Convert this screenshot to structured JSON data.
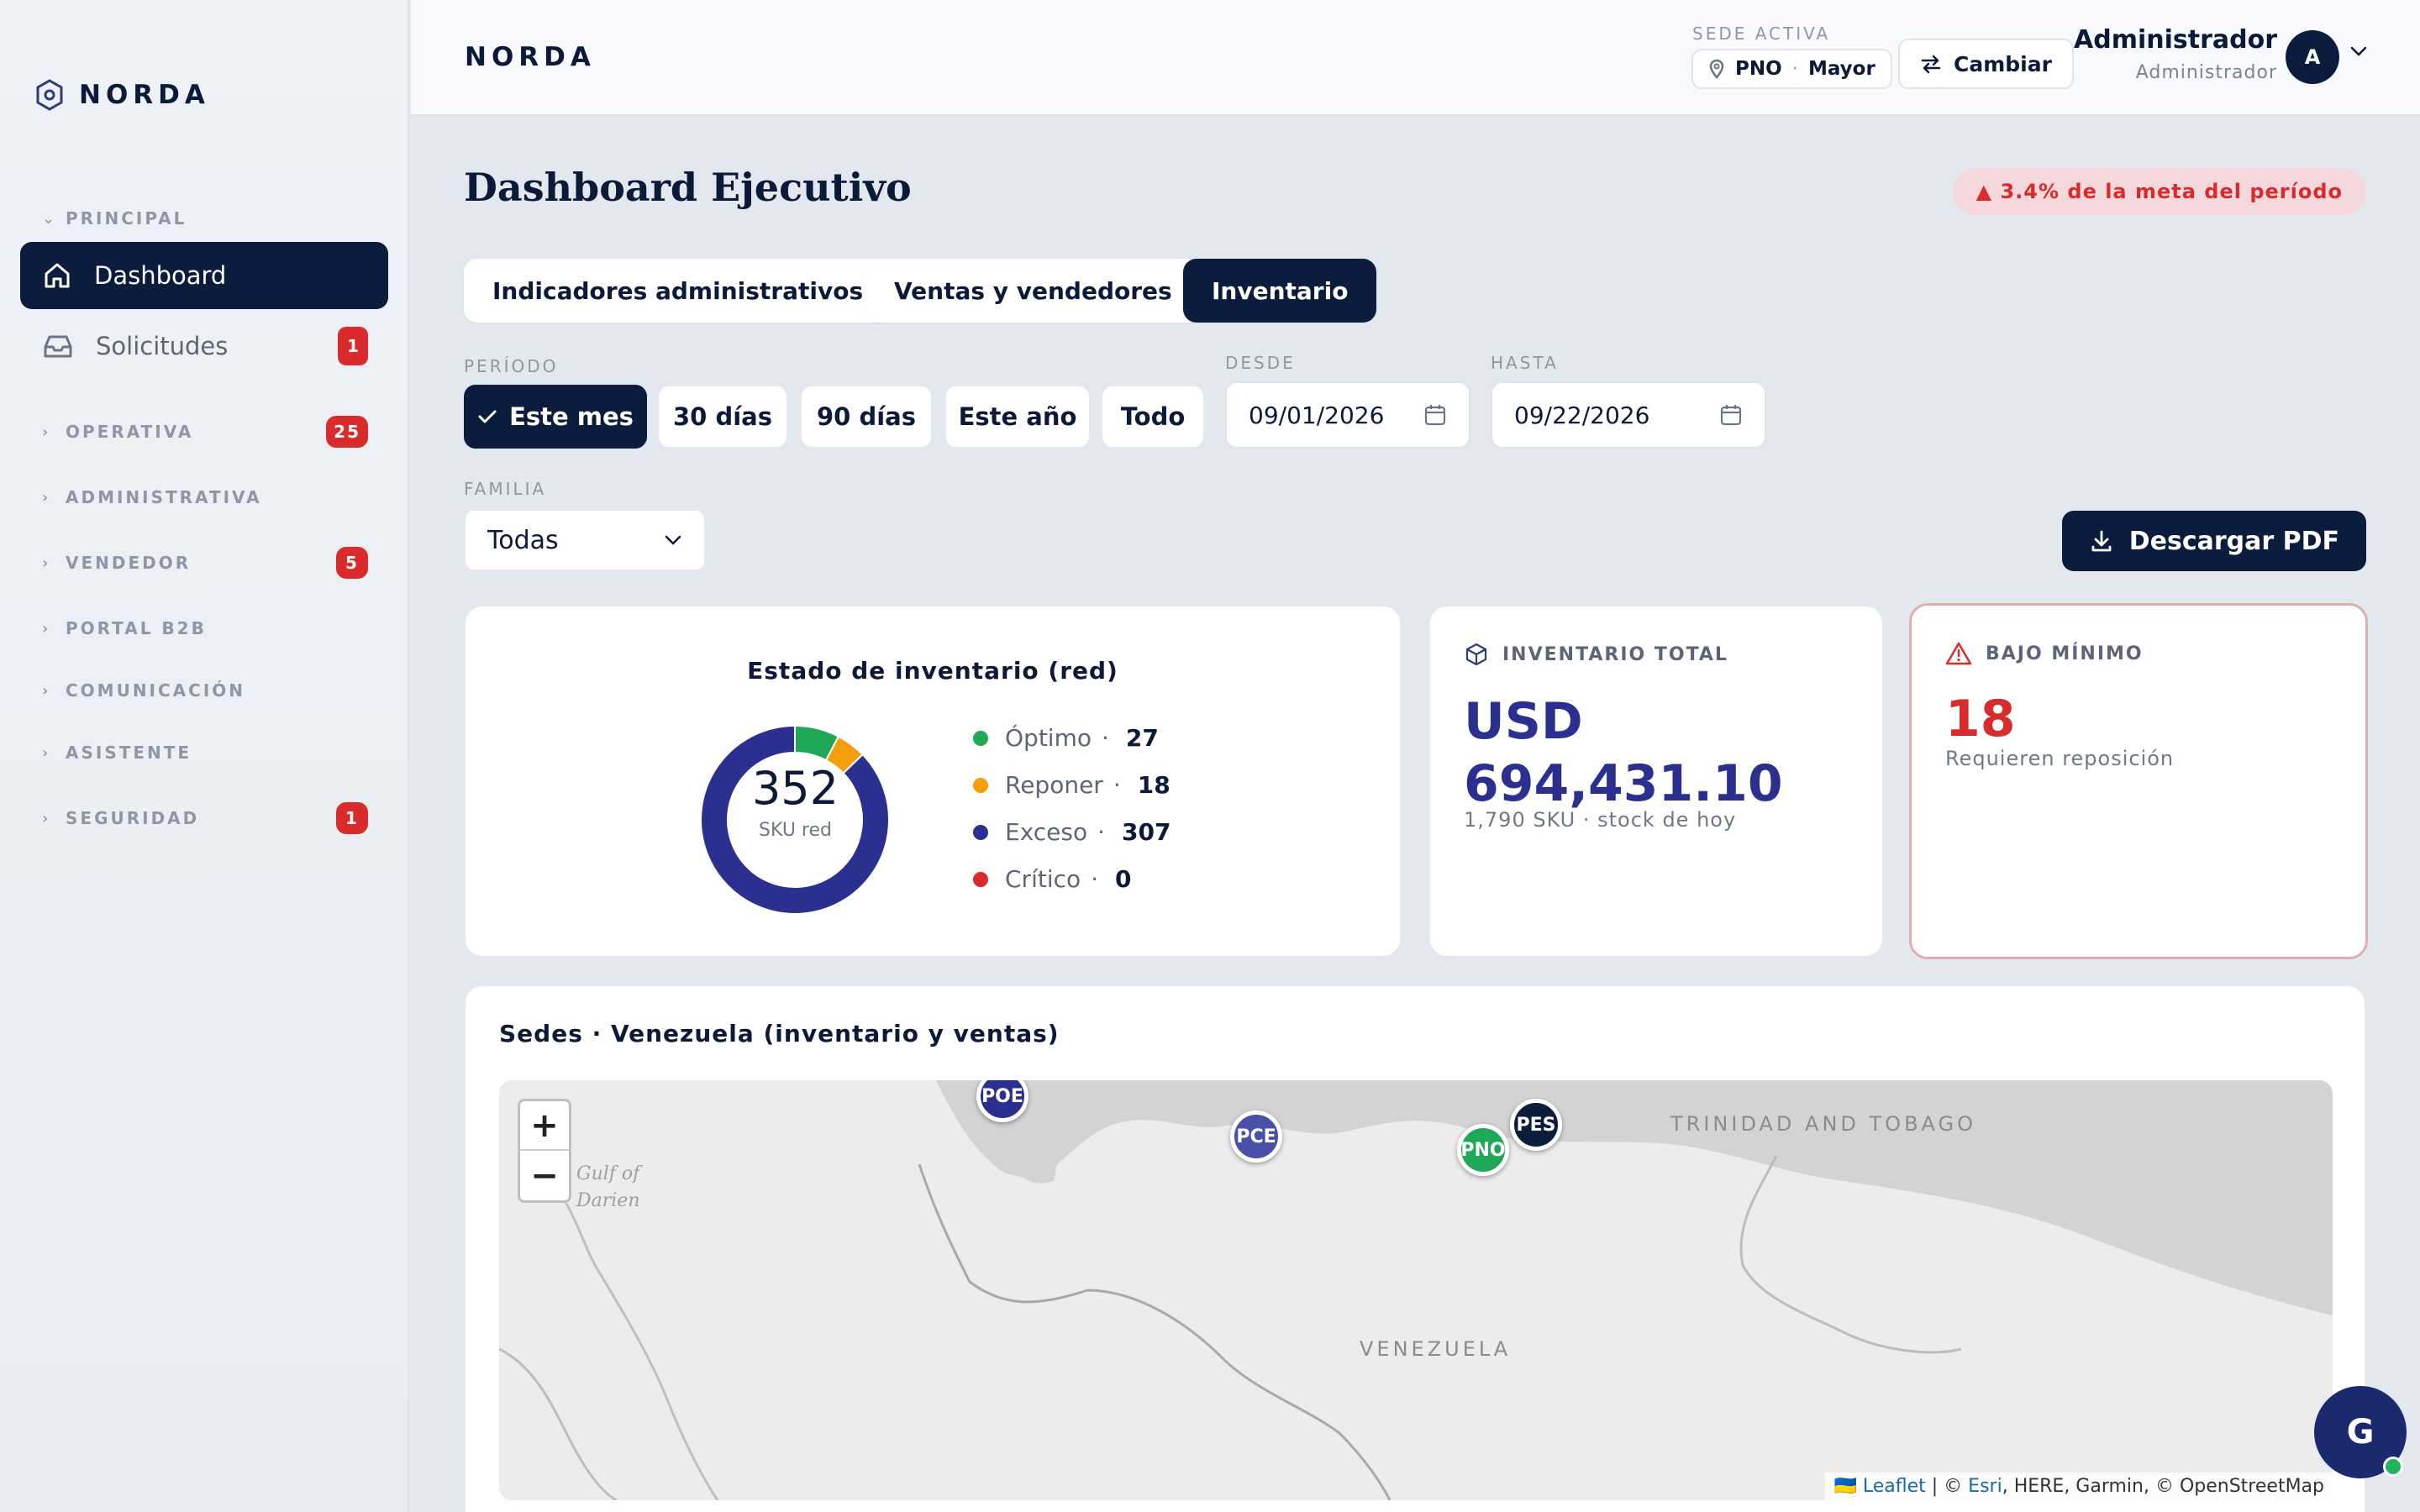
{
  "sidebar": {
    "brand": "NORDA",
    "sections": [
      {
        "label": "PRINCIPAL",
        "chevron": "⌄",
        "badge": null
      },
      {
        "label": "OPERATIVA",
        "chevron": "›",
        "badge": "25"
      },
      {
        "label": "ADMINISTRATIVA",
        "chevron": "›",
        "badge": null
      },
      {
        "label": "VENDEDOR",
        "chevron": "›",
        "badge": "5"
      },
      {
        "label": "PORTAL B2B",
        "chevron": "›",
        "badge": null
      },
      {
        "label": "COMUNICACIÓN",
        "chevron": "›",
        "badge": null
      },
      {
        "label": "ASISTENTE",
        "chevron": "›",
        "badge": null
      },
      {
        "label": "SEGURIDAD",
        "chevron": "›",
        "badge": "1"
      }
    ],
    "items": [
      {
        "label": "Dashboard",
        "icon": "home-icon",
        "active": true
      },
      {
        "label": "Solicitudes",
        "icon": "inbox-icon",
        "badge": "1"
      }
    ]
  },
  "header": {
    "logo": "NORDA",
    "sede_label": "SEDE ACTIVA",
    "sede_code": "PNO",
    "sede_sep": "·",
    "sede_name": "Mayor",
    "cambiar": "Cambiar",
    "user_name": "Administrador",
    "user_role": "Administrador",
    "avatar": "A"
  },
  "main": {
    "title": "Dashboard Ejecutivo",
    "meta_pill": "▲ 3.4% de la meta del período",
    "tabs": [
      {
        "label": "Indicadores administrativos",
        "active": false
      },
      {
        "label": "Ventas y vendedores",
        "active": false
      },
      {
        "label": "Inventario",
        "active": true
      }
    ],
    "filters": {
      "periodo_label": "PERÍODO",
      "periods": [
        "Este mes",
        "30 días",
        "90 días",
        "Este año",
        "Todo"
      ],
      "active_period": "Este mes",
      "desde_label": "DESDE",
      "desde_value": "09/01/2026",
      "hasta_label": "HASTA",
      "hasta_value": "09/22/2026",
      "familia_label": "FAMILIA",
      "familia_value": "Todas"
    },
    "download_pdf": "Descargar PDF"
  },
  "inventory_status": {
    "title": "Estado de inventario (red)",
    "total": "352",
    "total_label": "SKU red",
    "items": [
      {
        "label": "Óptimo",
        "sep": "·",
        "value": "27",
        "color": "#1fa855"
      },
      {
        "label": "Reponer",
        "sep": "·",
        "value": "18",
        "color": "#f59e0b"
      },
      {
        "label": "Exceso",
        "sep": "·",
        "value": "307",
        "color": "#2b2f8f"
      },
      {
        "label": "Crítico",
        "sep": "·",
        "value": "0",
        "color": "#d92b2b"
      }
    ]
  },
  "chart_data": {
    "type": "pie",
    "title": "Estado de inventario (red)",
    "categories": [
      "Óptimo",
      "Reponer",
      "Exceso",
      "Crítico"
    ],
    "values": [
      27,
      18,
      307,
      0
    ],
    "colors": [
      "#1fa855",
      "#f59e0b",
      "#2b2f8f",
      "#d92b2b"
    ]
  },
  "kpi_inventory": {
    "label": "INVENTARIO TOTAL",
    "currency": "USD",
    "value": "694,431.10",
    "sub": "1,790 SKU · stock de hoy"
  },
  "kpi_bajo": {
    "label": "BAJO MÍNIMO",
    "value": "18",
    "sub": "Requieren reposición"
  },
  "map": {
    "title": "Sedes · Venezuela (inventario y ventas)",
    "zoom_in": "+",
    "zoom_out": "−",
    "labels": {
      "trinidad": "TRINIDAD AND TOBAGO",
      "venezuela": "VENEZUELA",
      "darien_1": "Gulf of",
      "darien_2": "Darien"
    },
    "markers": [
      {
        "code": "POE",
        "color": "#2b2f8f"
      },
      {
        "code": "PCE",
        "color": "#4a4fa8"
      },
      {
        "code": "PNO",
        "color": "#1fa855"
      },
      {
        "code": "PES",
        "color": "#0b1c3d"
      }
    ],
    "attribution": {
      "flag": "🇺🇦",
      "leaflet": "Leaflet",
      "sep1": " | © ",
      "esri": "Esri",
      "rest": ", HERE, Garmin, © OpenStreetMap"
    }
  },
  "floating": {
    "letter": "G"
  }
}
